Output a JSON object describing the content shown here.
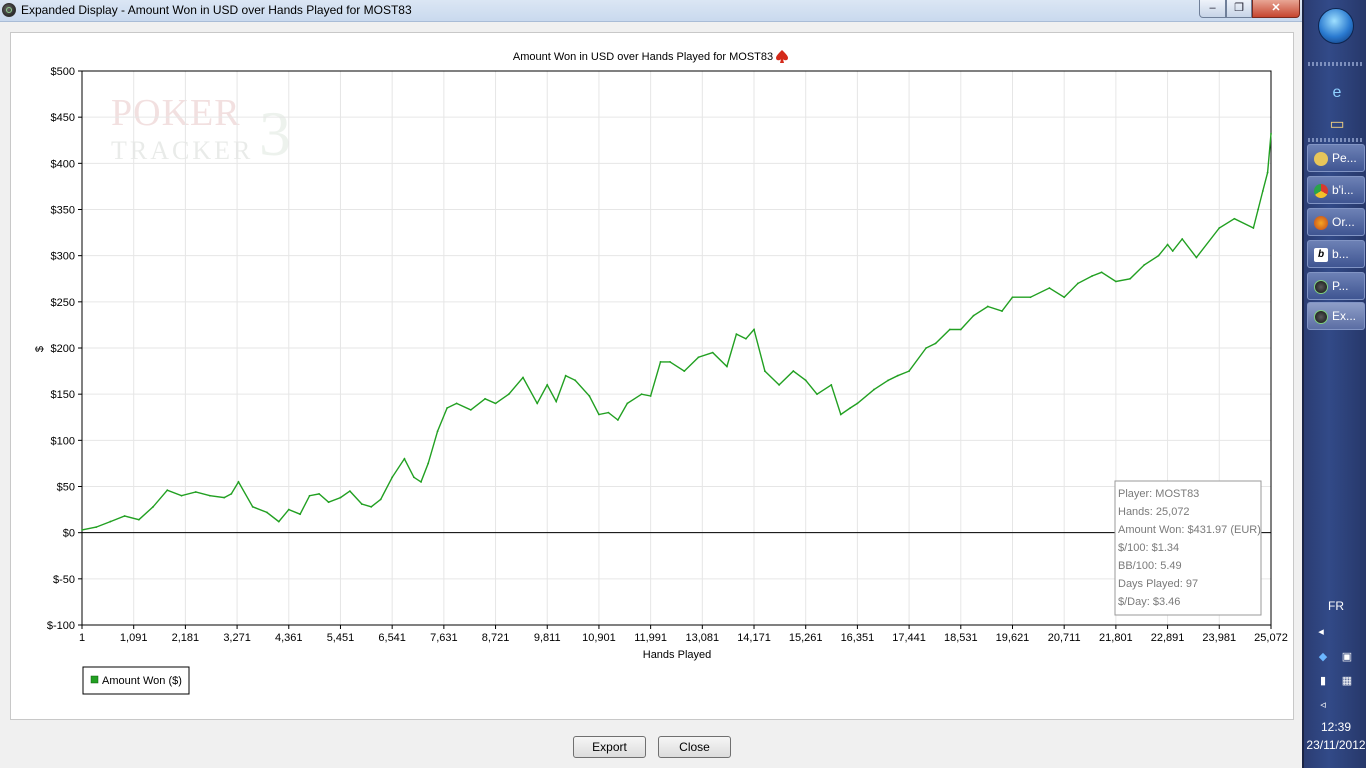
{
  "window": {
    "title": "Expanded Display - Amount Won in USD over Hands Played for MOST83",
    "controls": {
      "minimize": "–",
      "maximize": "❐",
      "close": "✕"
    }
  },
  "buttons": {
    "export": "Export",
    "close": "Close"
  },
  "watermark": {
    "line1": "POKER",
    "line2": "TRACKER",
    "badge": "3"
  },
  "colors": {
    "series": "#22a022",
    "axis": "#000000",
    "grid": "#e6e6e6",
    "infobox_text": "#7a7a7a"
  },
  "chart_data": {
    "type": "line",
    "title": "Amount Won in USD over Hands Played for MOST83",
    "title_icon": "red-spade-icon",
    "xlabel": "Hands Played",
    "ylabel": "$",
    "xlim": [
      1,
      25072
    ],
    "ylim": [
      -100,
      500
    ],
    "grid": true,
    "x_ticks": [
      "1",
      "1,091",
      "2,181",
      "3,271",
      "4,361",
      "5,451",
      "6,541",
      "7,631",
      "8,721",
      "9,811",
      "10,901",
      "11,991",
      "13,081",
      "14,171",
      "15,261",
      "16,351",
      "17,441",
      "18,531",
      "19,621",
      "20,711",
      "21,801",
      "22,891",
      "23,981",
      "25,072"
    ],
    "y_ticks": [
      "$500",
      "$450",
      "$400",
      "$350",
      "$300",
      "$250",
      "$200",
      "$150",
      "$100",
      "$50",
      "$0",
      "$-50",
      "$-100"
    ],
    "legend_position": "bottom-left",
    "series": [
      {
        "name": "Amount Won ($)",
        "color": "#22a022",
        "x": [
          1,
          300,
          600,
          900,
          1200,
          1500,
          1800,
          2100,
          2400,
          2700,
          3000,
          3150,
          3300,
          3600,
          3900,
          4150,
          4361,
          4600,
          4800,
          5000,
          5200,
          5451,
          5650,
          5900,
          6100,
          6300,
          6541,
          6800,
          7000,
          7150,
          7300,
          7500,
          7700,
          7900,
          8200,
          8500,
          8721,
          9000,
          9300,
          9600,
          9811,
          10000,
          10200,
          10400,
          10700,
          10901,
          11100,
          11300,
          11500,
          11800,
          11991,
          12200,
          12400,
          12700,
          13000,
          13300,
          13600,
          13800,
          14000,
          14171,
          14400,
          14700,
          15000,
          15261,
          15500,
          15800,
          16000,
          16200,
          16351,
          16700,
          17000,
          17200,
          17441,
          17800,
          18000,
          18300,
          18531,
          18800,
          19100,
          19400,
          19621,
          20000,
          20400,
          20711,
          21000,
          21300,
          21500,
          21801,
          22100,
          22400,
          22700,
          22891,
          23000,
          23200,
          23500,
          23981,
          24300,
          24700,
          24800,
          24900,
          25000,
          25072
        ],
        "values": [
          3,
          6,
          12,
          18,
          14,
          28,
          46,
          40,
          44,
          40,
          38,
          42,
          55,
          28,
          22,
          12,
          25,
          20,
          40,
          42,
          33,
          38,
          45,
          31,
          28,
          36,
          60,
          80,
          60,
          55,
          75,
          110,
          135,
          140,
          133,
          145,
          140,
          150,
          168,
          140,
          160,
          142,
          170,
          165,
          148,
          128,
          130,
          122,
          140,
          150,
          148,
          185,
          185,
          175,
          190,
          195,
          180,
          215,
          210,
          220,
          175,
          160,
          175,
          165,
          150,
          160,
          128,
          135,
          140,
          155,
          165,
          170,
          175,
          200,
          205,
          220,
          220,
          235,
          245,
          240,
          255,
          255,
          265,
          255,
          270,
          278,
          282,
          272,
          275,
          290,
          300,
          312,
          305,
          318,
          298,
          330,
          340,
          330,
          350,
          370,
          390,
          432
        ]
      }
    ],
    "info_box": {
      "player": "Player: MOST83",
      "hands": "Hands: 25,072",
      "amount_won": "Amount Won: $431.97 (EUR)",
      "per_100": "$/100: $1.34",
      "bb_100": "BB/100: 5.49",
      "days_played": "Days Played: 97",
      "per_day": "$/Day: $3.46"
    }
  },
  "taskbar": {
    "items": [
      {
        "label": "Pe...",
        "icon": "folder-icon"
      },
      {
        "label": "b'i...",
        "icon": "chrome-icon"
      },
      {
        "label": "Or...",
        "icon": "firefox-icon"
      },
      {
        "label": "b...",
        "icon": "b-app-icon"
      },
      {
        "label": "P...",
        "icon": "poker-tracker-icon"
      },
      {
        "label": "Ex...",
        "icon": "poker-tracker-icon"
      }
    ],
    "language": "FR",
    "time": "12:39",
    "date": "23/11/2012"
  }
}
